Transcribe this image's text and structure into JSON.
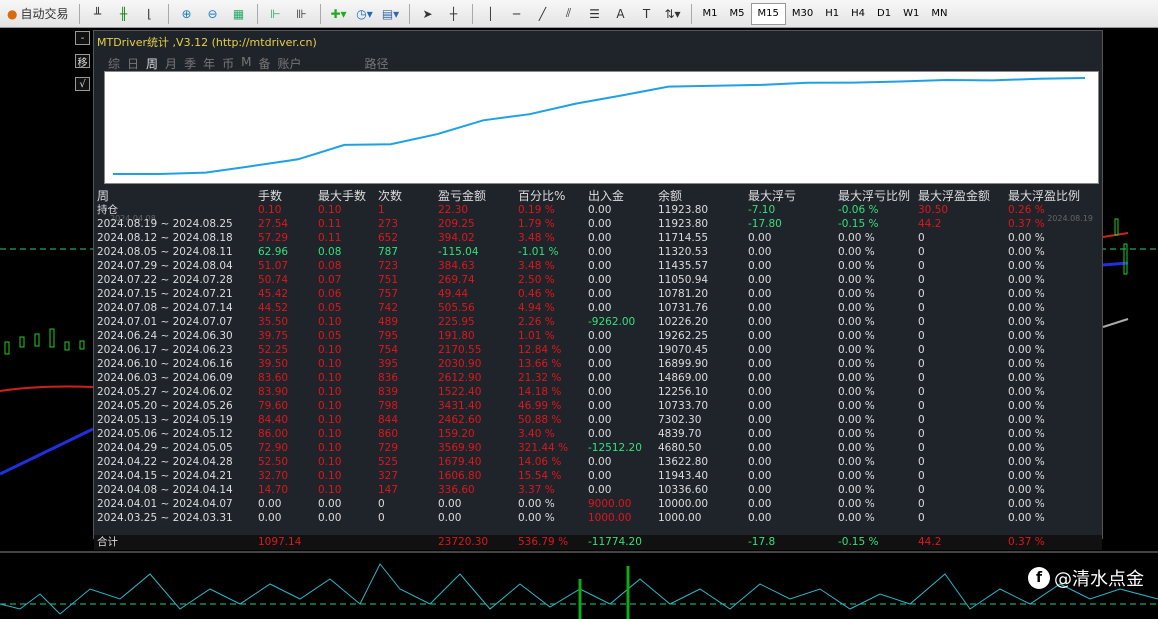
{
  "toolbar": {
    "autotrade_label": "自动交易",
    "timeframes": [
      "M1",
      "M5",
      "M15",
      "M30",
      "H1",
      "H4",
      "D1",
      "W1",
      "MN"
    ],
    "active_timeframe": "M15"
  },
  "side_buttons": [
    "-",
    "移",
    "√"
  ],
  "panel": {
    "title": "MTDriver统计 ,V3.12 (http://mtdriver.cn)",
    "tabs": [
      "综",
      "日",
      "周",
      "月",
      "季",
      "年",
      "币",
      "M",
      "备",
      "账户",
      "路径"
    ],
    "active_tab": "周",
    "equity_start_label": "2024.04.08",
    "equity_end_label": "2024.08.19",
    "colors": {
      "equity_line": "#1ea0e6",
      "profit": "#e0161c",
      "loss": "#36e07a"
    }
  },
  "table": {
    "headers": [
      "周",
      "手数",
      "最大手数",
      "次数",
      "盈亏金额",
      "百分比%",
      "出入金",
      "余额",
      "最大浮亏",
      "最大浮亏比例",
      "最大浮盈金额",
      "最大浮盈比例"
    ],
    "rows": [
      {
        "cells": [
          "持仓",
          "0.10",
          "0.10",
          "1",
          "22.30",
          "0.19 %",
          "0.00",
          "11923.80",
          "-7.10",
          "-0.06 %",
          "30.50",
          "0.26 %"
        ],
        "tone": "wrrrrrwwggrr"
      },
      {
        "cells": [
          "2024.08.19 ~ 2024.08.25",
          "27.54",
          "0.11",
          "273",
          "209.25",
          "1.79 %",
          "0.00",
          "11923.80",
          "-17.80",
          "-0.15 %",
          "44.2",
          "0.37 %"
        ],
        "tone": "wrrrrrwwggrr"
      },
      {
        "cells": [
          "2024.08.12 ~ 2024.08.18",
          "57.29",
          "0.11",
          "652",
          "394.02",
          "3.48 %",
          "0.00",
          "11714.55",
          "0.00",
          "0.00 %",
          "0",
          "0.00 %"
        ],
        "tone": "wrrrrrwwwwww"
      },
      {
        "cells": [
          "2024.08.05 ~ 2024.08.11",
          "62.96",
          "0.08",
          "787",
          "-115.04",
          "-1.01 %",
          "0.00",
          "11320.53",
          "0.00",
          "0.00 %",
          "0",
          "0.00 %"
        ],
        "tone": "wgggggwwwwww"
      },
      {
        "cells": [
          "2024.07.29 ~ 2024.08.04",
          "51.07",
          "0.08",
          "723",
          "384.63",
          "3.48 %",
          "0.00",
          "11435.57",
          "0.00",
          "0.00 %",
          "0",
          "0.00 %"
        ],
        "tone": "wrrrrrwwwwww"
      },
      {
        "cells": [
          "2024.07.22 ~ 2024.07.28",
          "50.74",
          "0.07",
          "751",
          "269.74",
          "2.50 %",
          "0.00",
          "11050.94",
          "0.00",
          "0.00 %",
          "0",
          "0.00 %"
        ],
        "tone": "wrrrrrwwwwww"
      },
      {
        "cells": [
          "2024.07.15 ~ 2024.07.21",
          "45.42",
          "0.06",
          "757",
          "49.44",
          "0.46 %",
          "0.00",
          "10781.20",
          "0.00",
          "0.00 %",
          "0",
          "0.00 %"
        ],
        "tone": "wrrrrrwwwwww"
      },
      {
        "cells": [
          "2024.07.08 ~ 2024.07.14",
          "44.52",
          "0.05",
          "742",
          "505.56",
          "4.94 %",
          "0.00",
          "10731.76",
          "0.00",
          "0.00 %",
          "0",
          "0.00 %"
        ],
        "tone": "wrrrrrwwwwww"
      },
      {
        "cells": [
          "2024.07.01 ~ 2024.07.07",
          "35.50",
          "0.10",
          "489",
          "225.95",
          "2.26 %",
          "-9262.00",
          "10226.20",
          "0.00",
          "0.00 %",
          "0",
          "0.00 %"
        ],
        "tone": "wrrrrrgwwwww"
      },
      {
        "cells": [
          "2024.06.24 ~ 2024.06.30",
          "39.75",
          "0.05",
          "795",
          "191.80",
          "1.01 %",
          "0.00",
          "19262.25",
          "0.00",
          "0.00 %",
          "0",
          "0.00 %"
        ],
        "tone": "wrrrrrwwwwww"
      },
      {
        "cells": [
          "2024.06.17 ~ 2024.06.23",
          "52.25",
          "0.10",
          "754",
          "2170.55",
          "12.84 %",
          "0.00",
          "19070.45",
          "0.00",
          "0.00 %",
          "0",
          "0.00 %"
        ],
        "tone": "wrrrrrwwwwww"
      },
      {
        "cells": [
          "2024.06.10 ~ 2024.06.16",
          "39.50",
          "0.10",
          "395",
          "2030.90",
          "13.66 %",
          "0.00",
          "16899.90",
          "0.00",
          "0.00 %",
          "0",
          "0.00 %"
        ],
        "tone": "wrrrrrwwwwww"
      },
      {
        "cells": [
          "2024.06.03 ~ 2024.06.09",
          "83.60",
          "0.10",
          "836",
          "2612.90",
          "21.32 %",
          "0.00",
          "14869.00",
          "0.00",
          "0.00 %",
          "0",
          "0.00 %"
        ],
        "tone": "wrrrrrwwwwww"
      },
      {
        "cells": [
          "2024.05.27 ~ 2024.06.02",
          "83.90",
          "0.10",
          "839",
          "1522.40",
          "14.18 %",
          "0.00",
          "12256.10",
          "0.00",
          "0.00 %",
          "0",
          "0.00 %"
        ],
        "tone": "wrrrrrwwwwww"
      },
      {
        "cells": [
          "2024.05.20 ~ 2024.05.26",
          "79.60",
          "0.10",
          "798",
          "3431.40",
          "46.99 %",
          "0.00",
          "10733.70",
          "0.00",
          "0.00 %",
          "0",
          "0.00 %"
        ],
        "tone": "wrrrrrwwwwww"
      },
      {
        "cells": [
          "2024.05.13 ~ 2024.05.19",
          "84.40",
          "0.10",
          "844",
          "2462.60",
          "50.88 %",
          "0.00",
          "7302.30",
          "0.00",
          "0.00 %",
          "0",
          "0.00 %"
        ],
        "tone": "wrrrrrwwwwww"
      },
      {
        "cells": [
          "2024.05.06 ~ 2024.05.12",
          "86.00",
          "0.10",
          "860",
          "159.20",
          "3.40 %",
          "0.00",
          "4839.70",
          "0.00",
          "0.00 %",
          "0",
          "0.00 %"
        ],
        "tone": "wrrrrrwwwwww"
      },
      {
        "cells": [
          "2024.04.29 ~ 2024.05.05",
          "72.90",
          "0.10",
          "729",
          "3569.90",
          "321.44 %",
          "-12512.20",
          "4680.50",
          "0.00",
          "0.00 %",
          "0",
          "0.00 %"
        ],
        "tone": "wrrrrrgwwwww"
      },
      {
        "cells": [
          "2024.04.22 ~ 2024.04.28",
          "52.50",
          "0.10",
          "525",
          "1679.40",
          "14.06 %",
          "0.00",
          "13622.80",
          "0.00",
          "0.00 %",
          "0",
          "0.00 %"
        ],
        "tone": "wrrrrrwwwwww"
      },
      {
        "cells": [
          "2024.04.15 ~ 2024.04.21",
          "32.70",
          "0.10",
          "327",
          "1606.80",
          "15.54 %",
          "0.00",
          "11943.40",
          "0.00",
          "0.00 %",
          "0",
          "0.00 %"
        ],
        "tone": "wrrrrrwwwwww"
      },
      {
        "cells": [
          "2024.04.08 ~ 2024.04.14",
          "14.70",
          "0.10",
          "147",
          "336.60",
          "3.37 %",
          "0.00",
          "10336.60",
          "0.00",
          "0.00 %",
          "0",
          "0.00 %"
        ],
        "tone": "wrrrrrwwwwww"
      },
      {
        "cells": [
          "2024.04.01 ~ 2024.04.07",
          "0.00",
          "0.00",
          "0",
          "0.00",
          "0.00 %",
          "9000.00",
          "10000.00",
          "0.00",
          "0.00 %",
          "0",
          "0.00 %"
        ],
        "tone": "wwwwwwrwwwww"
      },
      {
        "cells": [
          "2024.03.25 ~ 2024.03.31",
          "0.00",
          "0.00",
          "0",
          "0.00",
          "0.00 %",
          "1000.00",
          "1000.00",
          "0.00",
          "0.00 %",
          "0",
          "0.00 %"
        ],
        "tone": "wwwwwwrwwwww"
      }
    ],
    "total": {
      "cells": [
        "合计",
        "1097.14",
        "",
        "",
        "23720.30",
        "536.79 %",
        "-11774.20",
        "",
        "-17.8",
        "-0.15 %",
        "44.2",
        "0.37 %"
      ],
      "tone": "wrrrrrgwggrr"
    }
  },
  "watermark": "@清水点金"
}
